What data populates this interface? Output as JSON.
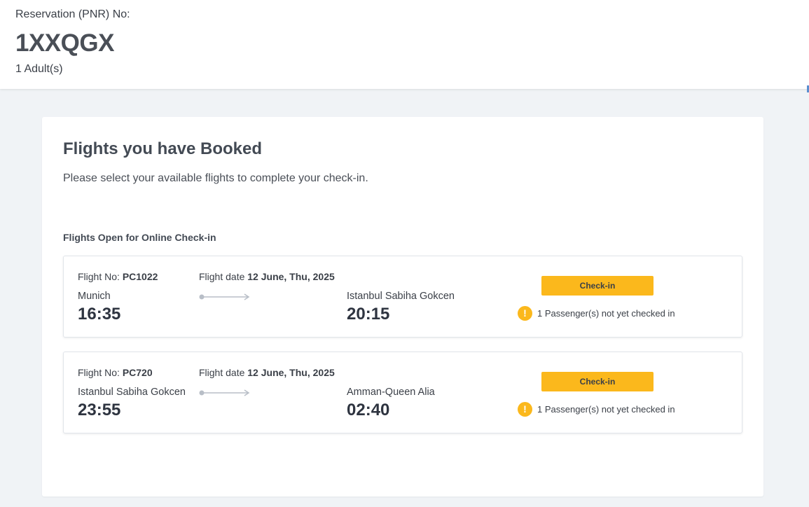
{
  "header": {
    "pnr_label": "Reservation (PNR) No:",
    "pnr_code": "1XXQGX",
    "pax_count": "1 Adult(s)"
  },
  "panel": {
    "title": "Flights you have Booked",
    "subtitle": "Please select your available flights to complete your check-in.",
    "section_title": "Flights Open for Online Check-in"
  },
  "labels": {
    "flight_no": "Flight No:",
    "flight_date": "Flight date",
    "checkin_button": "Check-in",
    "warning_icon": "!"
  },
  "flights": [
    {
      "number": "PC1022",
      "date": "12 June, Thu, 2025",
      "origin_city": "Munich",
      "origin_time": "16:35",
      "dest_city": "Istanbul Sabiha Gokcen",
      "dest_time": "20:15",
      "status": "1 Passenger(s) not yet checked in"
    },
    {
      "number": "PC720",
      "date": "12 June, Thu, 2025",
      "origin_city": "Istanbul Sabiha Gokcen",
      "origin_time": "23:55",
      "dest_city": "Amman-Queen Alia",
      "dest_time": "02:40",
      "status": "1 Passenger(s) not yet checked in"
    }
  ],
  "icons": {
    "route": "route-arrow-icon",
    "warning": "warning-icon"
  },
  "colors": {
    "accent": "#fbb81c",
    "page_bg": "#f0f3f6",
    "text": "#3a3f47"
  }
}
